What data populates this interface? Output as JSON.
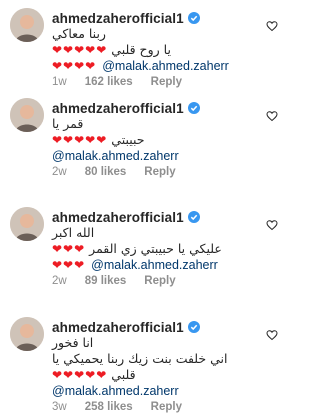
{
  "comments": [
    {
      "username": "ahmedzaherofficial1",
      "lines": [
        {
          "arabic": "ربنا معاكي",
          "hearts": ""
        },
        {
          "arabic": "يا روح قلبي",
          "hearts": "❤❤❤❤❤"
        },
        {
          "mention": "@malak.ahmed.zaherr",
          "hearts": "❤❤❤❤"
        }
      ],
      "time": "1w",
      "likes": "162 likes",
      "reply": "Reply"
    },
    {
      "username": "ahmedzaherofficial1",
      "lines": [
        {
          "arabic": "قمر يا",
          "hearts": ""
        },
        {
          "arabic": "حبيبتي",
          "hearts": "❤❤❤❤❤"
        },
        {
          "mention": "@malak.ahmed.zaherr",
          "hearts": ""
        }
      ],
      "time": "2w",
      "likes": "80 likes",
      "reply": "Reply"
    },
    {
      "username": "ahmedzaherofficial1",
      "lines": [
        {
          "arabic": "الله اكبر",
          "hearts": ""
        },
        {
          "arabic": "عليكي يا حبيبتي زي القمر",
          "hearts": "❤❤❤"
        },
        {
          "mention": "@malak.ahmed.zaherr",
          "hearts": "❤❤❤"
        }
      ],
      "time": "2w",
      "likes": "89 likes",
      "reply": "Reply"
    },
    {
      "username": "ahmedzaherofficial1",
      "lines": [
        {
          "arabic": "انا فخور",
          "hearts": ""
        },
        {
          "arabic": "اني خلفت بنت زيك ربنا يحميكي يا",
          "hearts": ""
        },
        {
          "arabic": "قلبي",
          "hearts": "❤❤❤❤❤"
        },
        {
          "mention": "@malak.ahmed.zaherr",
          "hearts": ""
        }
      ],
      "time": "3w",
      "likes": "258 likes",
      "reply": "Reply"
    }
  ],
  "colors": {
    "heart": "#ed1c24",
    "mention": "#00376b",
    "meta": "#8e8e8e",
    "verified": "#3897f0"
  },
  "icons": {
    "verified": "verified-badge-icon",
    "like": "heart-outline-icon"
  }
}
